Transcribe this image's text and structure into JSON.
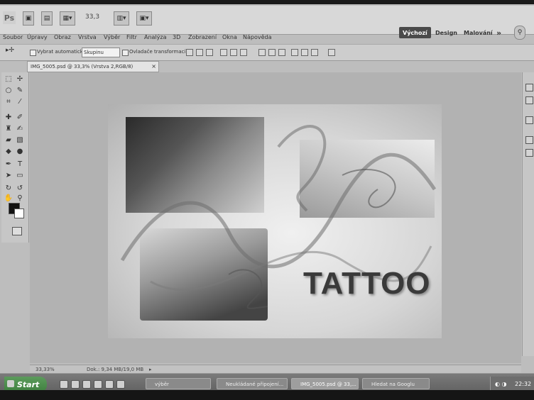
{
  "appbar": {
    "logo": "Ps",
    "zoom": "33,3",
    "workspaces": [
      "Výchozí",
      "Design",
      "Malování"
    ],
    "more": "»"
  },
  "menu": [
    "Soubor",
    "Úpravy",
    "Obraz",
    "Vrstva",
    "Výběr",
    "Filtr",
    "Analýza",
    "3D",
    "Zobrazení",
    "Okna",
    "Nápověda"
  ],
  "options": {
    "auto_select_label": "Vybrat automaticky:",
    "auto_select_value": "Skupinu",
    "transform_label": "Ovladače transformací"
  },
  "document": {
    "tab_title": "IMG_5005.psd @ 33,3% (Vrstva 2,RGB/8)",
    "close": "×"
  },
  "artwork": {
    "headline": "TATTOO"
  },
  "status": {
    "zoom": "33,33%",
    "doc_size": "Dok.: 9,34 MB/19,0 MB"
  },
  "taskbar": {
    "start": "Start",
    "tasks": [
      {
        "label": "výběr",
        "active": false
      },
      {
        "label": "Neukládané připojení...",
        "active": false
      },
      {
        "label": "IMG_5005.psd @ 33,...",
        "active": true
      },
      {
        "label": "Hledat na Googlu",
        "active": false
      }
    ],
    "clock": "22:32"
  },
  "colors": {
    "screen_bg": "#bdbdbd",
    "foreground_swatch": "#111111",
    "background_swatch": "#ffffff"
  }
}
